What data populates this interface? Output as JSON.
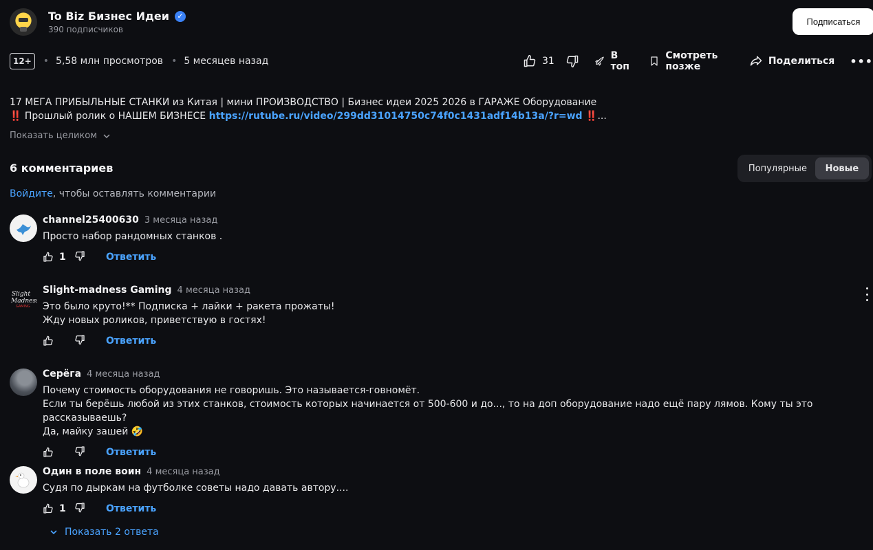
{
  "channel": {
    "name": "To Biz Бизнес Идеи",
    "subscribers": "390 подписчиков",
    "subscribe_label": "Подписаться"
  },
  "video": {
    "age_rating": "12+",
    "views": "5,58 млн просмотров",
    "published": "5 месяцев назад",
    "likes": "31",
    "actions": {
      "top": "В топ",
      "watch_later": "Смотреть позже",
      "share": "Поделиться"
    },
    "description": {
      "line1": "17 МЕГА ПРИБЫЛЬНЫЕ СТАНКИ из Китая | мини ПРОИЗВОДСТВО | Бизнес идеи 2025 2026 в ГАРАЖЕ Оборудование",
      "line2_mark": "‼️",
      "line2_text": " Прошлый ролик о НАШЕМ БИЗНЕСЕ ",
      "line2_link": "https://rutube.ru/video/299dd31014750c74f0c1431adf14b13a/?r=wd",
      "line2_tail": "...",
      "show_more": "Показать целиком"
    }
  },
  "comments_section": {
    "title": "6 комментариев",
    "sort": {
      "popular": "Популярные",
      "new": "Новые"
    },
    "login_link": "Войдите",
    "login_rest": ", чтобы оставлять комментарии",
    "reply_label": "Ответить",
    "show_replies": "Показать 2 ответа",
    "comments": [
      {
        "author": "channel25400630",
        "time": "3 месяца назад",
        "lines": [
          "Просто набор рандомных станков ."
        ],
        "likes": "1"
      },
      {
        "author": "Slight-madness Gaming",
        "time": "4 месяца назад",
        "lines": [
          "Это было круто!** Подписка + лайки + ракета прожаты!",
          "Жду новых роликов, приветствую в гостях!"
        ],
        "likes": ""
      },
      {
        "author": "Серёга",
        "time": "4 месяца назад",
        "lines": [
          "Почему стоимость оборудования не говоришь. Это называется-говномёт.",
          "Если ты берёшь любой из этих станков, стоимость которых начинается от 500-600 и до..., то на доп оборудование надо ещё пару лямов. Кому ты это рассказываешь?",
          "Да, майку зашей 🤣"
        ],
        "likes": ""
      },
      {
        "author": "Один в поле воин",
        "time": "4 месяца назад",
        "lines": [
          "Судя по дыркам на футболке советы надо давать автору...."
        ],
        "likes": "1"
      }
    ]
  },
  "colors": {
    "accent": "#4aa3ff",
    "background": "#0d0e12",
    "verified": "#3b82f6"
  }
}
